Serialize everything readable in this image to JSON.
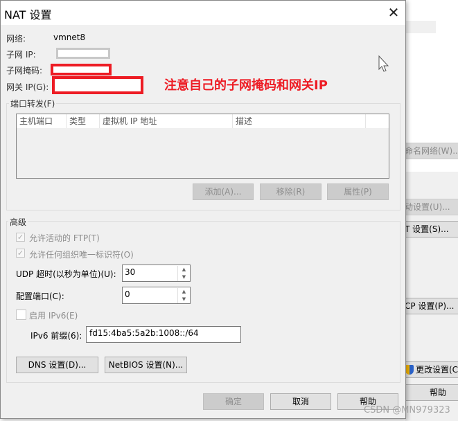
{
  "background": {
    "buttons": [
      {
        "label": "命名网络(W)...",
        "disabled": true
      },
      {
        "label": "动设置(U)...",
        "disabled": true
      },
      {
        "label": "T 设置(S)...",
        "disabled": false
      },
      {
        "label": "CP 设置(P)...",
        "disabled": false
      },
      {
        "label": "更改设置(C)",
        "disabled": false
      },
      {
        "label": "帮助",
        "disabled": false
      }
    ]
  },
  "dialog": {
    "title": "NAT 设置",
    "close_icon": "close-icon",
    "network_label": "网络:",
    "network_value": "vmnet8",
    "subnet_ip_label": "子网 IP:",
    "subnet_mask_label": "子网掩码:",
    "gateway_label": "网关 IP(G):",
    "annotation": "注意自己的子网掩码和网关IP",
    "annotation_color": "#ed1c24",
    "port_forwarding": {
      "title": "端口转发(F)",
      "columns": [
        "主机端口",
        "类型",
        "虚拟机 IP 地址",
        "描述"
      ],
      "rows": [],
      "add": "添加(A)...",
      "remove": "移除(R)",
      "properties": "属性(P)"
    },
    "advanced": {
      "title": "高级",
      "allow_ftp": {
        "label": "允许活动的 FTP(T)",
        "checked": true
      },
      "allow_oui": {
        "label": "允许任何组织唯一标识符(O)",
        "checked": true
      },
      "udp_timeout_label": "UDP 超时(以秒为单位)(U):",
      "udp_timeout_value": "30",
      "config_port_label": "配置端口(C):",
      "config_port_value": "0",
      "enable_ipv6": {
        "label": "启用 IPv6(E)",
        "checked": false
      },
      "ipv6_prefix_label": "IPv6 前缀(6):",
      "ipv6_prefix_value": "fd15:4ba5:5a2b:1008::/64",
      "dns": "DNS 设置(D)...",
      "netbios": "NetBIOS 设置(N)..."
    },
    "ok": "确定",
    "cancel": "取消",
    "help": "帮助"
  },
  "watermark": "CSDN @MN979323"
}
